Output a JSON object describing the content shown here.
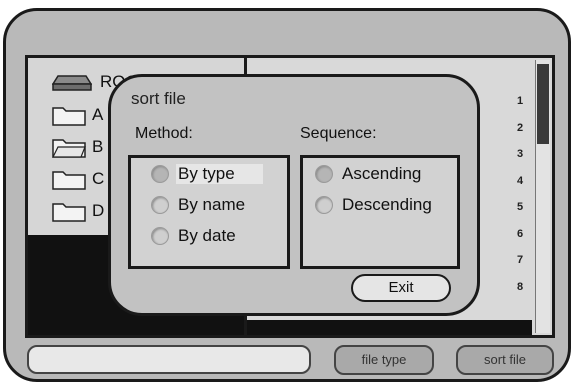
{
  "file_tree": {
    "root_label": "ROO",
    "items": [
      "A",
      "B",
      "C",
      "D"
    ]
  },
  "list_numbers": [
    "1",
    "2",
    "3",
    "4",
    "5",
    "6",
    "7",
    "8"
  ],
  "dialog": {
    "title": "sort file",
    "method_label": "Method:",
    "sequence_label": "Sequence:",
    "method_options": [
      "By type",
      "By name",
      "By date"
    ],
    "sequence_options": [
      "Ascending",
      "Descending"
    ],
    "selected_method": "By type",
    "selected_sequence": "Ascending",
    "exit_label": "Exit"
  },
  "bottom_bar": {
    "input_value": "",
    "file_type_label": "file type",
    "sort_file_label": "sort file"
  },
  "icons": {
    "root": "drive-icon",
    "folder": "folder-icon",
    "radio": "radio-button-icon"
  },
  "colors": {
    "frame": "#b9b9b9",
    "dialog": "#c2c2c2",
    "outline": "#1a1a1a"
  }
}
